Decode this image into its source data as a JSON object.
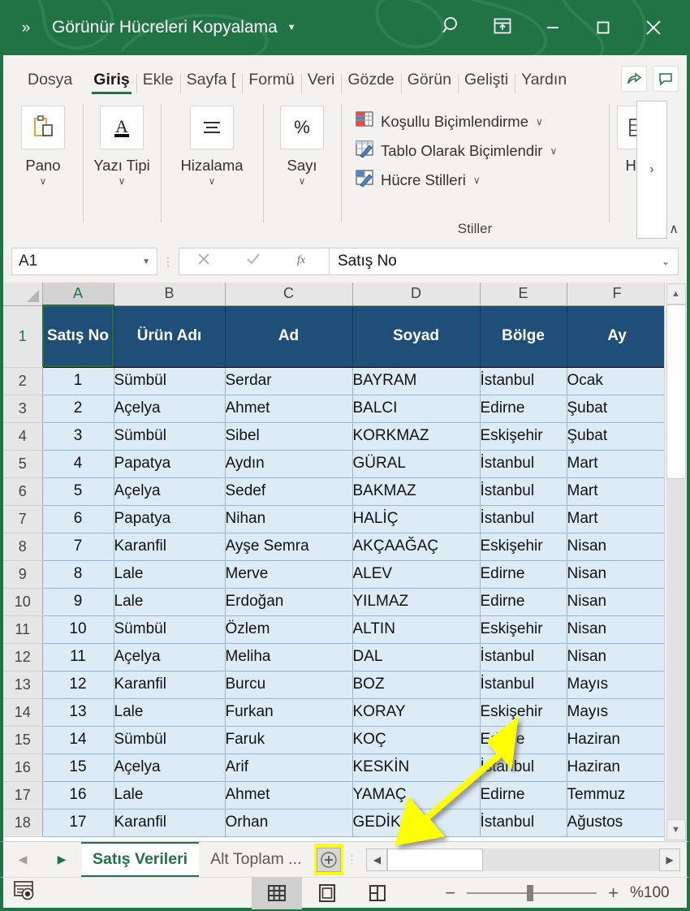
{
  "titlebar": {
    "chevrons": "»",
    "document_title": "Görünür Hücreleri Kopyalama",
    "title_caret": "▼",
    "search_icon": "search-icon",
    "restore_icon": "ribbon-display-options-icon",
    "minimize_label": "—",
    "maximize_label": "☐",
    "close_label": "✕"
  },
  "ribbon": {
    "tabs": [
      {
        "label": "Dosya",
        "active": false
      },
      {
        "label": "Giriş",
        "active": true
      },
      {
        "label": "Ekle",
        "active": false
      },
      {
        "label": "Sayfa [",
        "active": false
      },
      {
        "label": "Formü",
        "active": false
      },
      {
        "label": "Veri",
        "active": false
      },
      {
        "label": "Gözde",
        "active": false
      },
      {
        "label": "Görün",
        "active": false
      },
      {
        "label": "Gelişti",
        "active": false
      },
      {
        "label": "Yardın",
        "active": false
      }
    ],
    "share_icon": "share-icon",
    "comment_icon": "comment-icon",
    "groups": [
      {
        "label": "Pano",
        "caret": "∨",
        "icon": "clipboard-paste-icon"
      },
      {
        "label": "Yazı Tipi",
        "caret": "∨",
        "icon": "font-icon"
      },
      {
        "label": "Hizalama",
        "caret": "∨",
        "icon": "alignment-icon"
      },
      {
        "label": "Sayı",
        "caret": "∨",
        "icon": "percent-icon"
      }
    ],
    "styles": {
      "items": [
        {
          "label": "Koşullu Biçimlendirme",
          "caret": "∨",
          "icon": "conditional-formatting-icon"
        },
        {
          "label": "Tablo Olarak Biçimlendir",
          "caret": "∨",
          "icon": "format-as-table-icon"
        },
        {
          "label": "Hücre Stilleri",
          "caret": "∨",
          "icon": "cell-styles-icon"
        }
      ],
      "group_label": "Stiller"
    },
    "cells_group": {
      "label": "Hüc",
      "caret": "∨",
      "icon": "insert-cells-icon"
    },
    "overflow_chevron": "›",
    "collapse_chevron": "∧"
  },
  "formula_bar": {
    "name_box_value": "A1",
    "name_box_caret": "▼",
    "cancel_icon": "cancel-icon",
    "confirm_icon": "confirm-check-icon",
    "function_icon": "fx-icon",
    "formula_value": "Satış No",
    "expand_caret": "⌄"
  },
  "grid": {
    "columns": [
      {
        "letter": "A",
        "selected": true
      },
      {
        "letter": "B",
        "selected": false
      },
      {
        "letter": "C",
        "selected": false
      },
      {
        "letter": "D",
        "selected": false
      },
      {
        "letter": "E",
        "selected": false
      },
      {
        "letter": "F",
        "selected": false
      }
    ],
    "header_row_number": "1",
    "headers": [
      "Satış No",
      "Ürün Adı",
      "Ad",
      "Soyad",
      "Bölge",
      "Ay"
    ],
    "rows": [
      {
        "n": "2",
        "cells": [
          "1",
          "Sümbül",
          "Serdar",
          "BAYRAM",
          "İstanbul",
          "Ocak"
        ]
      },
      {
        "n": "3",
        "cells": [
          "2",
          "Açelya",
          "Ahmet",
          "BALCI",
          "Edirne",
          "Şubat"
        ]
      },
      {
        "n": "4",
        "cells": [
          "3",
          "Sümbül",
          "Sibel",
          "KORKMAZ",
          "Eskişehir",
          "Şubat"
        ]
      },
      {
        "n": "5",
        "cells": [
          "4",
          "Papatya",
          "Aydın",
          "GÜRAL",
          "İstanbul",
          "Mart"
        ]
      },
      {
        "n": "6",
        "cells": [
          "5",
          "Açelya",
          "Sedef",
          "BAKMAZ",
          "İstanbul",
          "Mart"
        ]
      },
      {
        "n": "7",
        "cells": [
          "6",
          "Papatya",
          "Nihan",
          "HALİÇ",
          "İstanbul",
          "Mart"
        ]
      },
      {
        "n": "8",
        "cells": [
          "7",
          "Karanfil",
          "Ayşe Semra",
          "AKÇAAĞAÇ",
          "Eskişehir",
          "Nisan"
        ]
      },
      {
        "n": "9",
        "cells": [
          "8",
          "Lale",
          "Merve",
          "ALEV",
          "Edirne",
          "Nisan"
        ]
      },
      {
        "n": "10",
        "cells": [
          "9",
          "Lale",
          "Erdoğan",
          "YILMAZ",
          "Edirne",
          "Nisan"
        ]
      },
      {
        "n": "11",
        "cells": [
          "10",
          "Sümbül",
          "Özlem",
          "ALTIN",
          "Eskişehir",
          "Nisan"
        ]
      },
      {
        "n": "12",
        "cells": [
          "11",
          "Açelya",
          "Meliha",
          "DAL",
          "İstanbul",
          "Nisan"
        ]
      },
      {
        "n": "13",
        "cells": [
          "12",
          "Karanfil",
          "Burcu",
          "BOZ",
          "İstanbul",
          "Mayıs"
        ]
      },
      {
        "n": "14",
        "cells": [
          "13",
          "Lale",
          "Furkan",
          "KORAY",
          "Eskişehir",
          "Mayıs"
        ]
      },
      {
        "n": "15",
        "cells": [
          "14",
          "Sümbül",
          "Faruk",
          "KOÇ",
          "Edirne",
          "Haziran"
        ]
      },
      {
        "n": "16",
        "cells": [
          "15",
          "Açelya",
          "Arif",
          "KESKİN",
          "İstanbul",
          "Haziran"
        ]
      },
      {
        "n": "17",
        "cells": [
          "16",
          "Lale",
          "Ahmet",
          "YAMAÇ",
          "Edirne",
          "Temmuz"
        ]
      },
      {
        "n": "18",
        "cells": [
          "17",
          "Karanfil",
          "Orhan",
          "GEDİK",
          "İstanbul",
          "Ağustos"
        ]
      }
    ]
  },
  "sheet_tabs": {
    "nav_first": "◀",
    "nav_last": "▶",
    "tabs": [
      {
        "label": "Satış Verileri",
        "active": true
      },
      {
        "label": "Alt Toplam ...",
        "active": false
      }
    ],
    "add_sheet_label": "+",
    "scroll_left": "◀",
    "scroll_right": "▶"
  },
  "status_bar": {
    "accessibility_icon": "accessibility-checker-icon",
    "views": [
      {
        "name": "normal-view-icon",
        "active": true
      },
      {
        "name": "page-layout-view-icon",
        "active": false
      },
      {
        "name": "page-break-view-icon",
        "active": false
      }
    ],
    "zoom_out": "−",
    "zoom_in": "+",
    "zoom_level": "%100"
  },
  "colors": {
    "excel_green": "#217346",
    "header_navy": "#1F4E78",
    "cell_fill": "#DDEBF7",
    "highlight_yellow": "#FFFF00",
    "arrow_yellow": "#FFFF00"
  }
}
